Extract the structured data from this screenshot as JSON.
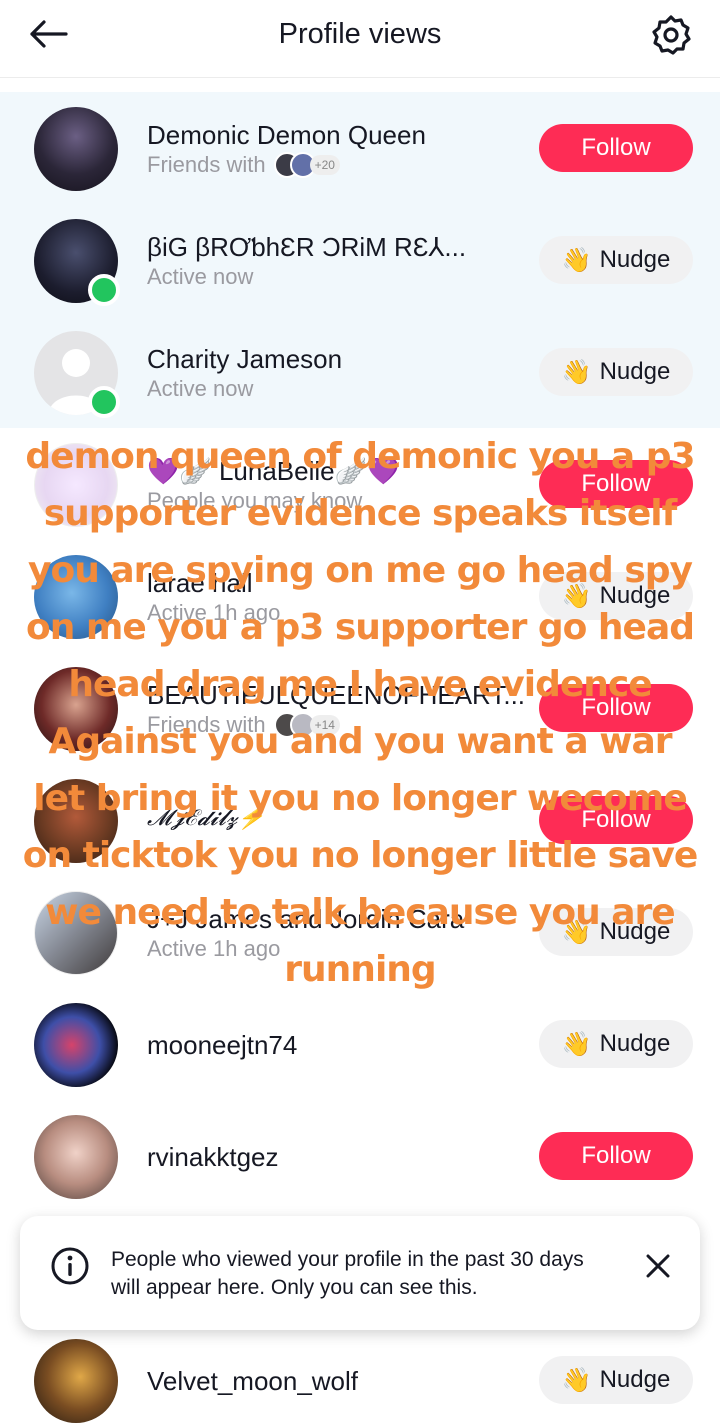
{
  "header": {
    "title": "Profile views"
  },
  "viewers": [
    {
      "name": "Demonic Demon Queen",
      "subtitle": "Friends with",
      "extra_count": "+20",
      "action": "Follow",
      "online": false,
      "highlight": true
    },
    {
      "name": "βiG βRƠƅhƐR ƆRiΜ RƐ⅄...",
      "subtitle": "Active now",
      "action": "Nudge",
      "online": true,
      "highlight": true
    },
    {
      "name": "Charity Jameson",
      "subtitle": "Active now",
      "action": "Nudge",
      "online": true,
      "highlight": true
    },
    {
      "name": "💜🪽 LunaBelle🪽💜",
      "subtitle": "People you may know",
      "action": "Follow",
      "online": false,
      "highlight": false
    },
    {
      "name": "larae hall",
      "subtitle": "Active 1h ago",
      "action": "Nudge",
      "online": false,
      "highlight": false
    },
    {
      "name": "BEAUTIFULQUEENOFHEART...",
      "subtitle": "Friends with",
      "extra_count": "+14",
      "action": "Follow",
      "online": false,
      "highlight": false
    },
    {
      "name": "𝓜𝓳ℰ𝓭𝓲𝓵𝔃⚡",
      "subtitle": "",
      "action": "Follow",
      "online": false,
      "highlight": false
    },
    {
      "name": "J+J James and Jordin Cara",
      "subtitle": "Active 1h ago",
      "action": "Nudge",
      "online": false,
      "highlight": false
    },
    {
      "name": "mooneejtn74",
      "subtitle": "",
      "action": "Nudge",
      "online": false,
      "highlight": false
    },
    {
      "name": "rvinakktgez",
      "subtitle": "",
      "action": "Follow",
      "online": false,
      "highlight": false
    },
    {
      "name": "Velvet_moon_wolf",
      "subtitle": "",
      "action": "Nudge",
      "online": false,
      "highlight": false
    }
  ],
  "overlay_caption": "demon queen of demonic you a p3 supporter evidence speaks itself you are spying on me go head spy on me you a p3 supporter go head head drag me I have evidence Against you and you want a war let bring it you no longer wecome on ticktok you no longer little save we need to talk because you are running",
  "toast": {
    "message": "People who viewed your profile in the past 30 days will appear here. Only you can see this."
  },
  "colors": {
    "follow": "#fe2c55",
    "nudge_bg": "#f1f1f2",
    "online": "#22c55e",
    "highlight_row": "#f1f8fc",
    "overlay_text": "#f28a3a"
  },
  "icons": {
    "back": "arrow-left-icon",
    "settings": "gear-icon",
    "nudge": "waving-hand-icon",
    "info": "info-circle-icon",
    "close": "close-icon"
  }
}
